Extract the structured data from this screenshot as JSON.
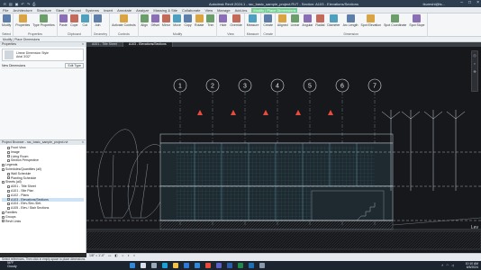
{
  "titlebar": {
    "title": "Autodesk Revit 2024.1 - rac_basic_sample_project.RVT - Section: A103 - Elevations/Sections",
    "user": "tkureshi@ts...",
    "qat_icons": [
      "revit-logo-icon",
      "open-icon",
      "save-icon",
      "undo-icon",
      "redo-icon",
      "print-icon"
    ]
  },
  "ribbon_tabs": [
    "File",
    "Architecture",
    "Structure",
    "Steel",
    "Precast",
    "Systems",
    "Insert",
    "Annotate",
    "Analyze",
    "Massing & Site",
    "Collaborate",
    "View",
    "Manage",
    "Add-Ins",
    "Modify | Place Dimensions"
  ],
  "ribbon": {
    "groups": [
      {
        "label": "Select",
        "buttons": [
          "Modify"
        ]
      },
      {
        "label": "Properties",
        "buttons": [
          "Properties",
          "Type Properties"
        ]
      },
      {
        "label": "Clipboard",
        "buttons": [
          "Paste",
          "Cope",
          "Cut"
        ]
      },
      {
        "label": "Geometry",
        "buttons": [
          "Join"
        ]
      },
      {
        "label": "Controls",
        "buttons": [
          "Activate Controls"
        ]
      },
      {
        "label": "Modify",
        "buttons": [
          "Align",
          "Offset",
          "Mirror",
          "Move",
          "Copy",
          "Rotate",
          "Trim"
        ]
      },
      {
        "label": "View",
        "buttons": [
          "Hide",
          "Override"
        ]
      },
      {
        "label": "Measure",
        "buttons": [
          "Measure"
        ]
      },
      {
        "label": "Create",
        "buttons": [
          "Create"
        ]
      },
      {
        "label": "Dimension",
        "buttons": [
          "Aligned",
          "Linear",
          "Angular",
          "Radial",
          "Diameter",
          "Arc Length",
          "Spot Elevation",
          "Spot Coordinate",
          "Spot Slope"
        ]
      }
    ]
  },
  "optionsbar": {
    "text": "Modify | Place Dimensions"
  },
  "properties": {
    "title": "Properties",
    "type_name": "Linear Dimension Style",
    "type_sub": "Arial 3/32\"",
    "view_label": "New Dimensions",
    "edit_type": "Edit Type"
  },
  "browser": {
    "title": "Properties   Type Selector",
    "header": "Project Browser - rac_basic_sample_project.rvt",
    "items": [
      {
        "label": "Front View",
        "level": 1
      },
      {
        "label": "Image",
        "level": 1
      },
      {
        "label": "Living Room",
        "level": 1
      },
      {
        "label": "Section Perspective",
        "level": 1
      },
      {
        "label": "Legends",
        "level": 0
      },
      {
        "label": "Schedules/Quantities (all)",
        "level": 0
      },
      {
        "label": "Wall Schedule",
        "level": 1
      },
      {
        "label": "Planting Schedule",
        "level": 1
      },
      {
        "label": "Sheets (all)",
        "level": 0
      },
      {
        "label": "A001 - Title Sheet",
        "level": 1
      },
      {
        "label": "A101 - Site Plan",
        "level": 1
      },
      {
        "label": "A102 - Plans",
        "level": 1
      },
      {
        "label": "A103 - Elevations/Sections",
        "level": 1,
        "selected": true
      },
      {
        "label": "A104 - Elev./Sec./Det.",
        "level": 1
      },
      {
        "label": "A105 - Elev./ Stair Sections",
        "level": 1
      },
      {
        "label": "Families",
        "level": 0
      },
      {
        "label": "Groups",
        "level": 0
      },
      {
        "label": "Revit Links",
        "level": 0
      }
    ]
  },
  "view_tabs": [
    {
      "label": "A001 - Title Sheet",
      "active": false
    },
    {
      "label": "A103 - Elevations/Sections",
      "active": true
    }
  ],
  "canvas": {
    "gridlines": [
      "1",
      "2",
      "3",
      "4",
      "5",
      "6",
      "7"
    ],
    "level_label": "Lev"
  },
  "viewbar": {
    "scale": "1/8\" = 1'-0\""
  },
  "statusbar": {
    "text": "Select references, Then click in empty space to place dimensions."
  },
  "taskbar": {
    "temperature": "56°F",
    "condition": "Cloudy",
    "time": "10:10 AM",
    "date": "6/5/2024",
    "app_icons": [
      "windows-icon",
      "search-icon",
      "task-view-icon",
      "edge-icon",
      "explorer-icon",
      "store-icon",
      "mail-icon",
      "chrome-icon",
      "teams-icon",
      "word-icon",
      "excel-icon",
      "revit-icon",
      "settings-icon"
    ],
    "app_colors": [
      "#2f88d8",
      "#d9e2ec",
      "#9aa7b6",
      "#1aa0d8",
      "#f1c14b",
      "#2f78d8",
      "#2f88d8",
      "#e84b3c",
      "#5b60c4",
      "#2b5ea8",
      "#1f8a4c",
      "#1f6fb5",
      "#8899aa"
    ]
  }
}
